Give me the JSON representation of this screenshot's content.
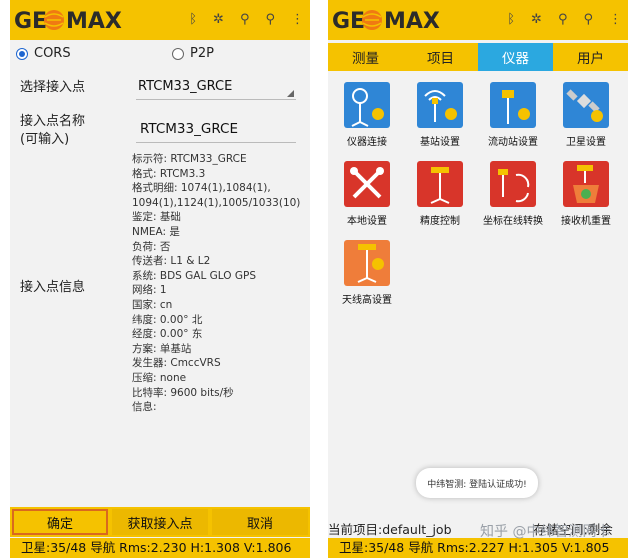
{
  "brand": {
    "logo": "GEOMAX"
  },
  "left": {
    "radio": {
      "cors": "CORS",
      "p2p": "P2P",
      "selected": "CORS"
    },
    "select_mount_label": "选择接入点",
    "select_mount_value": "RTCM33_GRCE",
    "mount_name_label_1": "接入点名称",
    "mount_name_label_2": "(可输入)",
    "mount_name_value": "RTCM33_GRCE",
    "info_label": "接入点信息",
    "info_lines": [
      "标示符: RTCM33_GRCE",
      "格式: RTCM3.3",
      "格式明细: 1074(1),1084(1),",
      "1094(1),1124(1),1005/1033(10)",
      "鉴定: 基础",
      "NMEA: 是",
      "负荷: 否",
      "传送者: L1 & L2",
      "系统: BDS GAL GLO GPS",
      "网络: 1",
      "国家: cn",
      "纬度: 0.00° 北",
      "经度: 0.00° 东",
      "方案: 单基站",
      "发生器: CmccVRS",
      "压缩: none",
      "比特率: 9600 bits/秒",
      "信息:"
    ],
    "buttons": {
      "ok": "确定",
      "get_mount": "获取接入点",
      "cancel": "取消"
    },
    "status": "卫星:35/48 导航 Rms:2.230 H:1.308 V:1.806"
  },
  "right": {
    "tabs": [
      "测量",
      "项目",
      "仪器",
      "用户"
    ],
    "active_tab": "仪器",
    "tiles": [
      {
        "label": "仪器连接",
        "icon": "instrument-connect-icon",
        "color": "#2f86d6"
      },
      {
        "label": "基站设置",
        "icon": "base-station-settings-icon",
        "color": "#2f86d6"
      },
      {
        "label": "流动站设置",
        "icon": "rover-settings-icon",
        "color": "#2f86d6"
      },
      {
        "label": "卫星设置",
        "icon": "satellite-settings-icon",
        "color": "#2f86d6"
      },
      {
        "label": "本地设置",
        "icon": "local-settings-icon",
        "color": "#d8352a"
      },
      {
        "label": "精度控制",
        "icon": "precision-control-icon",
        "color": "#d8352a"
      },
      {
        "label": "坐标在线转换",
        "icon": "coordinate-convert-icon",
        "color": "#d8352a"
      },
      {
        "label": "接收机重置",
        "icon": "receiver-reset-icon",
        "color": "#d8352a"
      },
      {
        "label": "天线高设置",
        "icon": "antenna-height-icon",
        "color": "#ef7d3a"
      }
    ],
    "toast": "中纬智测: 登陆认证成功!",
    "project": "当前项目:default_job",
    "project_suffix": "存储空间:剩余",
    "status": "卫星:35/48 导航 Rms:2.227 H:1.305 V:1.805"
  },
  "watermark": "知乎 @中纬智测网卡"
}
